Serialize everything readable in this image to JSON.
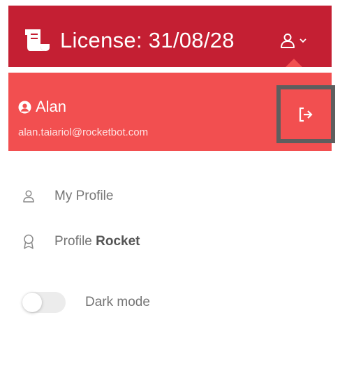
{
  "header": {
    "license_icon": "scroll-icon",
    "license_text": "License: 31/08/28",
    "user_menu_icon": "user-icon",
    "user_menu_chevron": "chevron-down-icon"
  },
  "account": {
    "icon": "user-circle-icon",
    "name": "Alan",
    "email": "alan.taiariol@rocketbot.com",
    "logout_icon": "sign-out-icon"
  },
  "menu": {
    "items": [
      {
        "icon": "user-icon",
        "label": "My Profile"
      },
      {
        "icon": "award-icon",
        "label_prefix": "Profile",
        "label_strong": "Rocket"
      }
    ],
    "dark_mode": {
      "label": "Dark mode",
      "enabled": false
    }
  },
  "colors": {
    "topbar": "#c41f33",
    "account_header": "#f24f50",
    "highlight_border": "#5e5e5e",
    "menu_text": "#757575"
  }
}
